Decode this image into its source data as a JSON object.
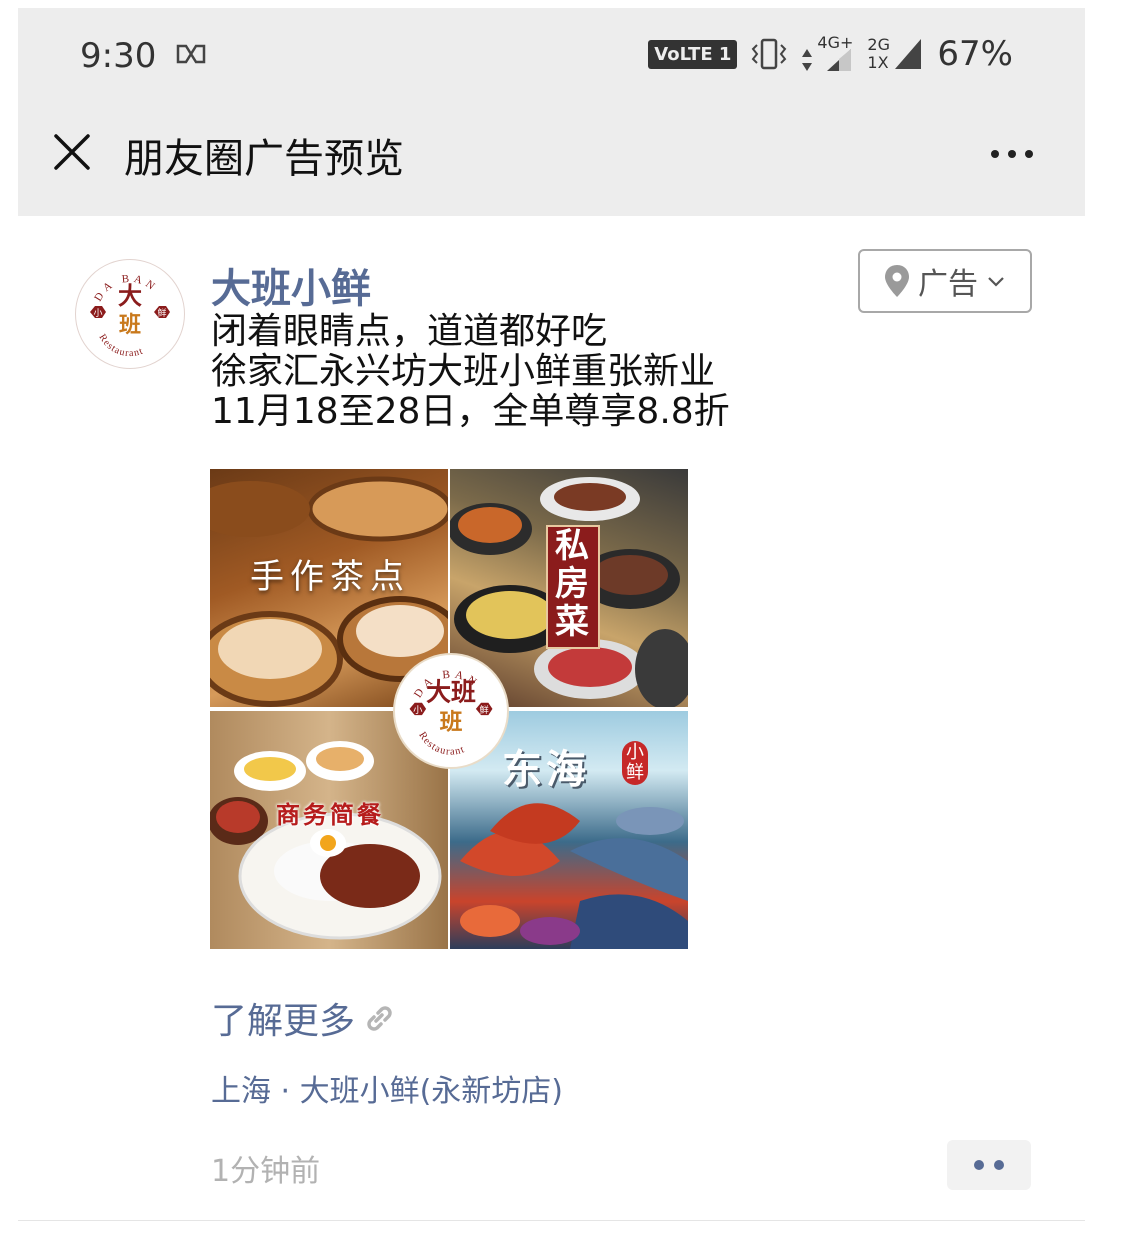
{
  "status_bar": {
    "time": "9:30",
    "volte": "VoLTE 1",
    "net_top": "4G+",
    "net_mid": "2G",
    "net_bottom": "1X",
    "battery": "67%"
  },
  "header": {
    "title": "朋友圈广告预览"
  },
  "post": {
    "brand_name": "大班小鲜",
    "ad_label": "广告",
    "lines": [
      "闭着眼睛点，道道都好吃",
      "徐家汇永兴坊大班小鲜重张新业",
      "11月18至28日，全单尊享8.8折"
    ],
    "images": {
      "tl": "手作茶点",
      "tr": "私房菜",
      "bl": "商务简餐",
      "br": "东海",
      "br_badge": "小鲜",
      "logo_top": "DA BAN",
      "logo_main": "大班",
      "logo_left": "小",
      "logo_right": "鲜",
      "logo_bottom": "Restaurant"
    },
    "learn_more": "了解更多",
    "location": "上海 · 大班小鲜(永新坊店)",
    "time_ago": "1分钟前"
  },
  "colors": {
    "link": "#576b95",
    "topbar": "#ededed",
    "logo_red": "#8b1c1c"
  }
}
